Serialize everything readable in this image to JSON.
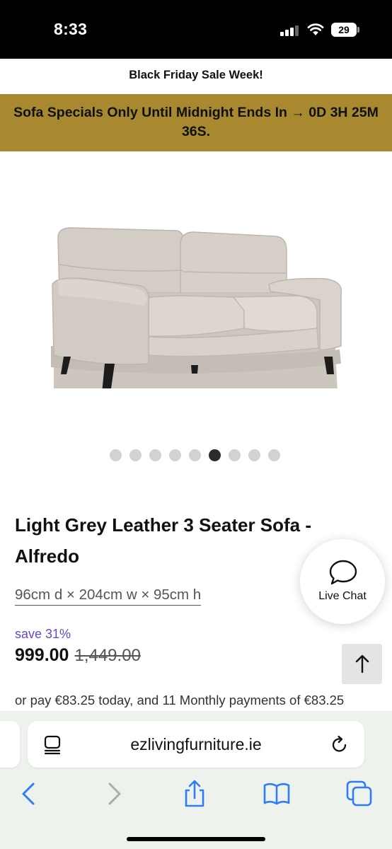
{
  "status_bar": {
    "time": "8:33",
    "battery": "29"
  },
  "promo": {
    "headline": "Black Friday Sale Week!",
    "countdown": "Sofa Specials Only Until Midnight Ends In → 0D 3H 25M 36S.",
    "banner_color": "#a88930"
  },
  "gallery": {
    "image_alt": "Light grey leather 3 seater sofa",
    "slide_count": 9,
    "active_slide": 6
  },
  "product": {
    "title": "Light Grey Leather 3 Seater Sofa - Alfredo",
    "dimensions": "96cm d × 204cm w × 95cm h",
    "save_label": "save 31%",
    "price": "999.00",
    "was_price": "1,449.00",
    "finance_text": "or pay €83.25 today, and 11 Monthly payments of €83.25"
  },
  "live_chat": {
    "label": "Live Chat",
    "icon": "chat-bubble-icon"
  },
  "scroll_top": {
    "icon": "arrow-up-icon"
  },
  "browser": {
    "url": "ezlivingfurniture.ie",
    "toolbar": [
      "back-icon",
      "forward-icon",
      "share-icon",
      "bookmarks-icon",
      "tabs-icon"
    ]
  },
  "colors": {
    "accent_purple": "#6a48c2",
    "browser_blue": "#2f7cf6",
    "browser_chrome_bg": "#eef2ec"
  }
}
